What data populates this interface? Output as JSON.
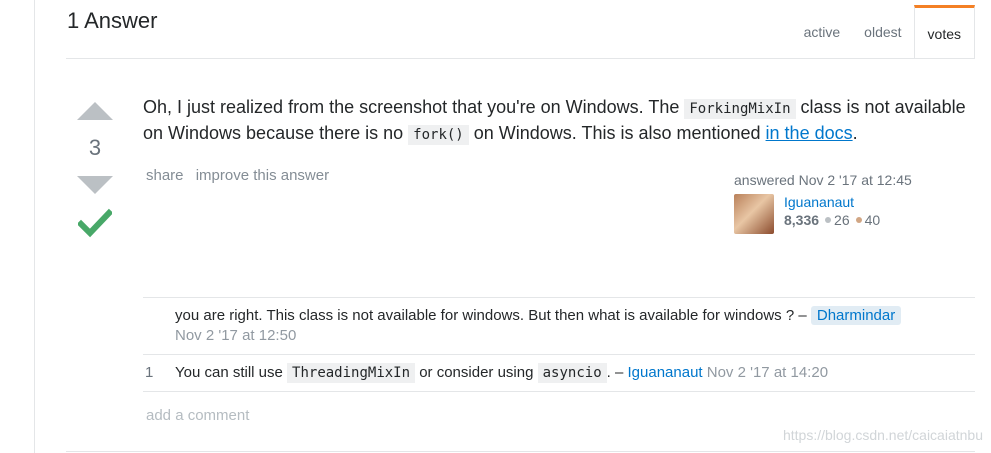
{
  "answers_header": {
    "title": "1 Answer",
    "tabs": [
      {
        "label": "active"
      },
      {
        "label": "oldest"
      },
      {
        "label": "votes",
        "selected": true
      }
    ]
  },
  "answer": {
    "score": "3",
    "accepted": true,
    "body": {
      "p1": "Oh, I just realized from the screenshot that you're on Windows. The ",
      "code1": "ForkingMixIn",
      "p2": " class is not available on Windows because there is no ",
      "code2": "fork()",
      "p3": " on Windows. This is also mentioned ",
      "link": "in the docs",
      "p4": "."
    },
    "menu": {
      "share": "share",
      "improve": "improve this answer"
    },
    "signature": {
      "action": "answered Nov 2 '17 at 12:45",
      "user": "Iguananaut",
      "reputation": "8,336",
      "silver_badges": "26",
      "bronze_badges": "40"
    }
  },
  "comments": [
    {
      "score": "",
      "text": "you are right. This class is not available for windows. But then what is available for windows ? – ",
      "user": "Dharmindar",
      "date": "Nov 2 '17 at 12:50"
    },
    {
      "score": "1",
      "t1": "You can still use ",
      "code1": "ThreadingMixIn",
      "t2": " or consider using ",
      "code2": "asyncio",
      "t3": ". – ",
      "user": "Iguananaut",
      "date": "Nov 2 '17 at 14:20"
    }
  ],
  "add_comment": "add a comment",
  "watermark": "https://blog.csdn.net/caicaiatnbu",
  "colors": {
    "link": "#0077cc",
    "accepted": "#48a868",
    "tab_accent": "#f48024",
    "silver": "#bbc0c4",
    "bronze": "#d1a684"
  }
}
